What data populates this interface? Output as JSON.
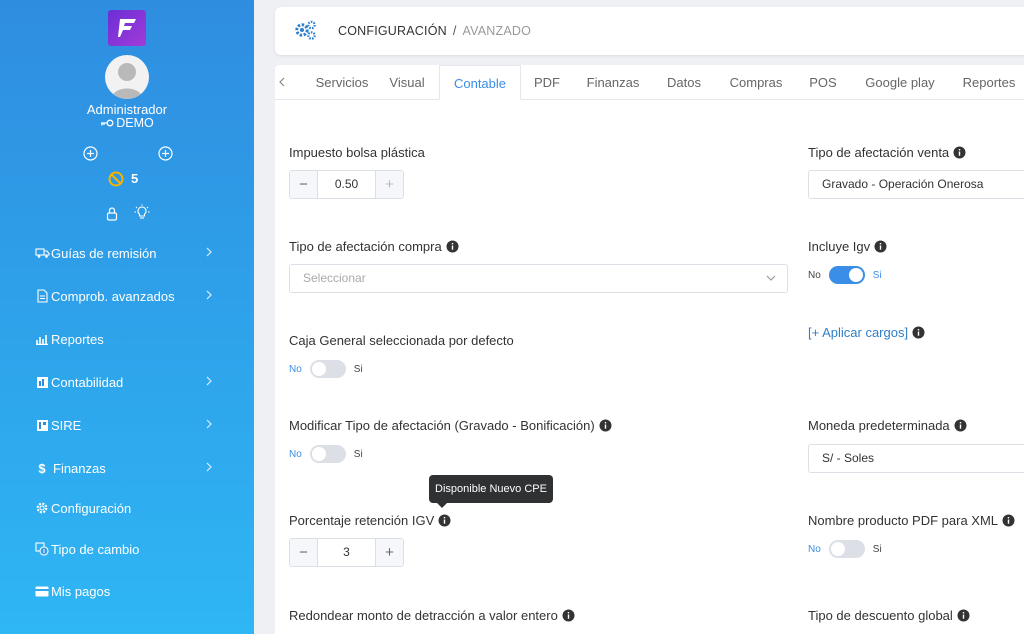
{
  "sidebar": {
    "user_name": "Administrador",
    "user_role": "DEMO",
    "notification_count": "5",
    "items": [
      {
        "label": "Guías de remisión",
        "icon": "truck-icon"
      },
      {
        "label": "Comprob. avanzados",
        "icon": "document-icon"
      },
      {
        "label": "Reportes",
        "icon": "bar-chart-icon"
      },
      {
        "label": "Contabilidad",
        "icon": "ledger-icon"
      },
      {
        "label": "SIRE",
        "icon": "sire-icon"
      },
      {
        "label": "Finanzas",
        "icon": "dollar-icon"
      },
      {
        "label": "Configuración",
        "icon": "gear-icon"
      },
      {
        "label": "Tipo de cambio",
        "icon": "exchange-icon"
      },
      {
        "label": "Mis pagos",
        "icon": "card-icon"
      }
    ]
  },
  "header": {
    "section": "CONFIGURACIÓN",
    "separator": "/",
    "subsection": "AVANZADO"
  },
  "tabs": [
    "Servicios",
    "Visual",
    "Contable",
    "PDF",
    "Finanzas",
    "Datos",
    "Compras",
    "POS",
    "Google play",
    "Reportes"
  ],
  "active_tab": "Contable",
  "form": {
    "bolsa_label": "Impuesto bolsa plástica",
    "bolsa_value": "0.50",
    "venta_label": "Tipo de afectación venta",
    "venta_value": "Gravado - Operación Onerosa",
    "compra_label": "Tipo de afectación compra",
    "compra_placeholder": "Seleccionar",
    "igv_label": "Incluye Igv",
    "igv_off": "No",
    "igv_on": "Si",
    "caja_label": "Caja General seleccionada por defecto",
    "caja_off": "No",
    "caja_on": "Si",
    "cargos_link": "[+ Aplicar cargos]",
    "modificar_label": "Modificar Tipo de afectación (Gravado - Bonificación)",
    "modificar_off": "No",
    "modificar_on": "Si",
    "moneda_label": "Moneda predeterminada",
    "moneda_value": "S/ - Soles",
    "tooltip": "Disponible Nuevo CPE",
    "retencion_label": "Porcentaje retención IGV",
    "retencion_value": "3",
    "nombre_pdf_label": "Nombre producto PDF para XML",
    "nombre_pdf_off": "No",
    "nombre_pdf_on": "Si",
    "redondear_label": "Redondear monto de detracción a valor entero",
    "descuento_label": "Tipo de descuento global"
  },
  "colors": {
    "accent": "#3a8ee6",
    "sidebar_top": "#2f8de0",
    "sidebar_bottom": "#2fb6f4"
  }
}
